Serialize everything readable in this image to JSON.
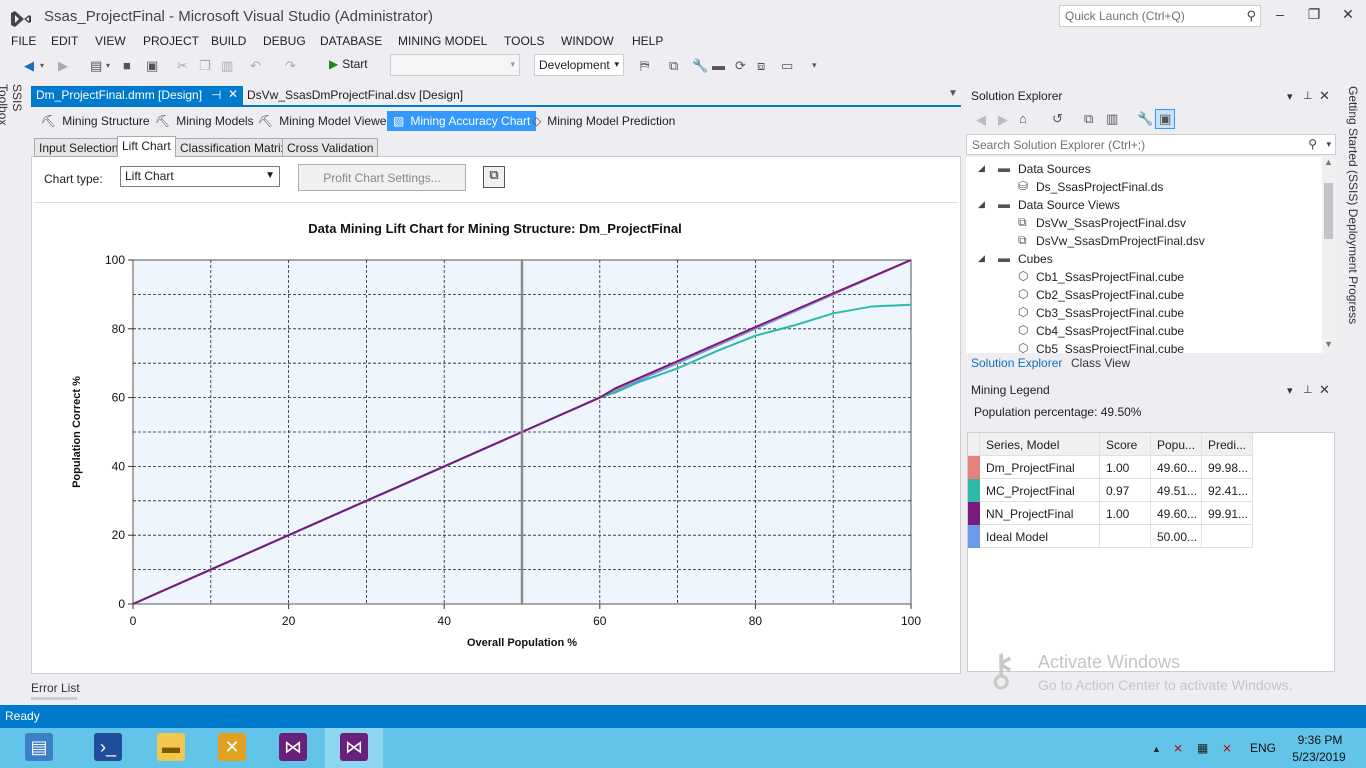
{
  "window": {
    "title": "Ssas_ProjectFinal - Microsoft Visual Studio (Administrator)",
    "quick_launch_placeholder": "Quick Launch (Ctrl+Q)",
    "minimize": "‒",
    "restore": "❐",
    "close": "✕"
  },
  "menu": [
    "FILE",
    "EDIT",
    "VIEW",
    "PROJECT",
    "BUILD",
    "DEBUG",
    "DATABASE",
    "MINING MODEL",
    "TOOLS",
    "WINDOW",
    "HELP"
  ],
  "toolbar": {
    "start_label": "Start",
    "configuration": "Development"
  },
  "side": {
    "ssis_toolbox": "SSIS Toolbox",
    "right_vertical": "Getting Started (SSIS)   Deployment Progress"
  },
  "doc_tabs": {
    "active": "Dm_ProjectFinal.dmm [Design]",
    "second": "DsVw_SsasDmProjectFinal.dsv [Design]"
  },
  "designer_tabs": [
    "Mining Structure",
    "Mining Models",
    "Mining Model Viewer",
    "Mining Accuracy Chart",
    "Mining Model Prediction"
  ],
  "sub_tabs": [
    "Input Selection",
    "Lift Chart",
    "Classification Matrix",
    "Cross Validation"
  ],
  "chart_controls": {
    "chart_type_label": "Chart type:",
    "chart_type_value": "Lift Chart",
    "profit_button": "Profit Chart Settings..."
  },
  "chart_data": {
    "type": "line",
    "title": "Data Mining Lift Chart for Mining Structure: Dm_ProjectFinal",
    "xlabel": "Overall Population %",
    "ylabel": "Population Correct %",
    "xlim": [
      0,
      100
    ],
    "ylim": [
      0,
      100
    ],
    "x_ticks": [
      "0",
      "20",
      "40",
      "60",
      "80",
      "100"
    ],
    "y_ticks": [
      "0",
      "20",
      "40",
      "60",
      "80",
      "100"
    ],
    "grid": true,
    "cursor_x": 50,
    "series": [
      {
        "name": "Dm_ProjectFinal",
        "color": "#e8817c",
        "x": [
          0,
          10,
          20,
          30,
          40,
          50,
          60,
          62,
          70,
          80,
          90,
          100
        ],
        "y": [
          0,
          10,
          20,
          30,
          40,
          50,
          60,
          62.5,
          70.5,
          80.4,
          90.2,
          100
        ]
      },
      {
        "name": "MC_ProjectFinal",
        "color": "#2ebaa6",
        "x": [
          0,
          10,
          20,
          30,
          40,
          50,
          60,
          62,
          65,
          70,
          75,
          80,
          85,
          90,
          95,
          100
        ],
        "y": [
          0,
          10,
          20,
          30,
          40,
          50,
          60,
          61.5,
          64.5,
          68.5,
          73.5,
          78,
          81,
          84.5,
          86.5,
          87
        ]
      },
      {
        "name": "NN_ProjectFinal",
        "color": "#7a1a7e",
        "x": [
          0,
          10,
          20,
          30,
          40,
          50,
          60,
          62,
          70,
          80,
          90,
          100
        ],
        "y": [
          0,
          10,
          20,
          30,
          40,
          50,
          60,
          62.7,
          70.6,
          80.5,
          90.3,
          100
        ]
      },
      {
        "name": "Ideal Model",
        "color": "#6b9bea",
        "x": [
          0,
          100
        ],
        "y": [
          0,
          100
        ]
      }
    ]
  },
  "error_list": "Error List",
  "solution_explorer": {
    "title": "Solution Explorer",
    "search_placeholder": "Search Solution Explorer (Ctrl+;)",
    "tree": [
      {
        "label": "Data Sources",
        "level": 0,
        "type": "folder"
      },
      {
        "label": "Ds_SsasProjectFinal.ds",
        "level": 1,
        "type": "ds"
      },
      {
        "label": "Data Source Views",
        "level": 0,
        "type": "folder"
      },
      {
        "label": "DsVw_SsasProjectFinal.dsv",
        "level": 1,
        "type": "dsv"
      },
      {
        "label": "DsVw_SsasDmProjectFinal.dsv",
        "level": 1,
        "type": "dsv"
      },
      {
        "label": "Cubes",
        "level": 0,
        "type": "folder"
      },
      {
        "label": "Cb1_SsasProjectFinal.cube",
        "level": 1,
        "type": "cube"
      },
      {
        "label": "Cb2_SsasProjectFinal.cube",
        "level": 1,
        "type": "cube"
      },
      {
        "label": "Cb3_SsasProjectFinal.cube",
        "level": 1,
        "type": "cube"
      },
      {
        "label": "Cb4_SsasProjectFinal.cube",
        "level": 1,
        "type": "cube"
      },
      {
        "label": "Cb5_SsasProjectFinal.cube",
        "level": 1,
        "type": "cube"
      }
    ],
    "tab_1": "Solution Explorer",
    "tab_2": "Class View"
  },
  "mining_legend": {
    "title": "Mining Legend",
    "population": "Population percentage: 49.50%",
    "headers": [
      "Series, Model",
      "Score",
      "Popu...",
      "Predi..."
    ],
    "rows": [
      {
        "model": "Dm_ProjectFinal",
        "score": "1.00",
        "popu": "49.60...",
        "predi": "99.98...",
        "color": "#e8817c"
      },
      {
        "model": "MC_ProjectFinal",
        "score": "0.97",
        "popu": "49.51...",
        "predi": "92.41...",
        "color": "#2ebaa6"
      },
      {
        "model": "NN_ProjectFinal",
        "score": "1.00",
        "popu": "49.60...",
        "predi": "99.91...",
        "color": "#7a1a7e"
      },
      {
        "model": "Ideal Model",
        "score": "",
        "popu": "50.00...",
        "predi": "",
        "color": "#6b9bea"
      }
    ]
  },
  "watermark": {
    "line1": "Activate Windows",
    "line2": "Go to Action Center to activate Windows."
  },
  "status": "Ready",
  "taskbar": {
    "lang": "ENG",
    "time": "9:36 PM",
    "date": "5/23/2019"
  }
}
